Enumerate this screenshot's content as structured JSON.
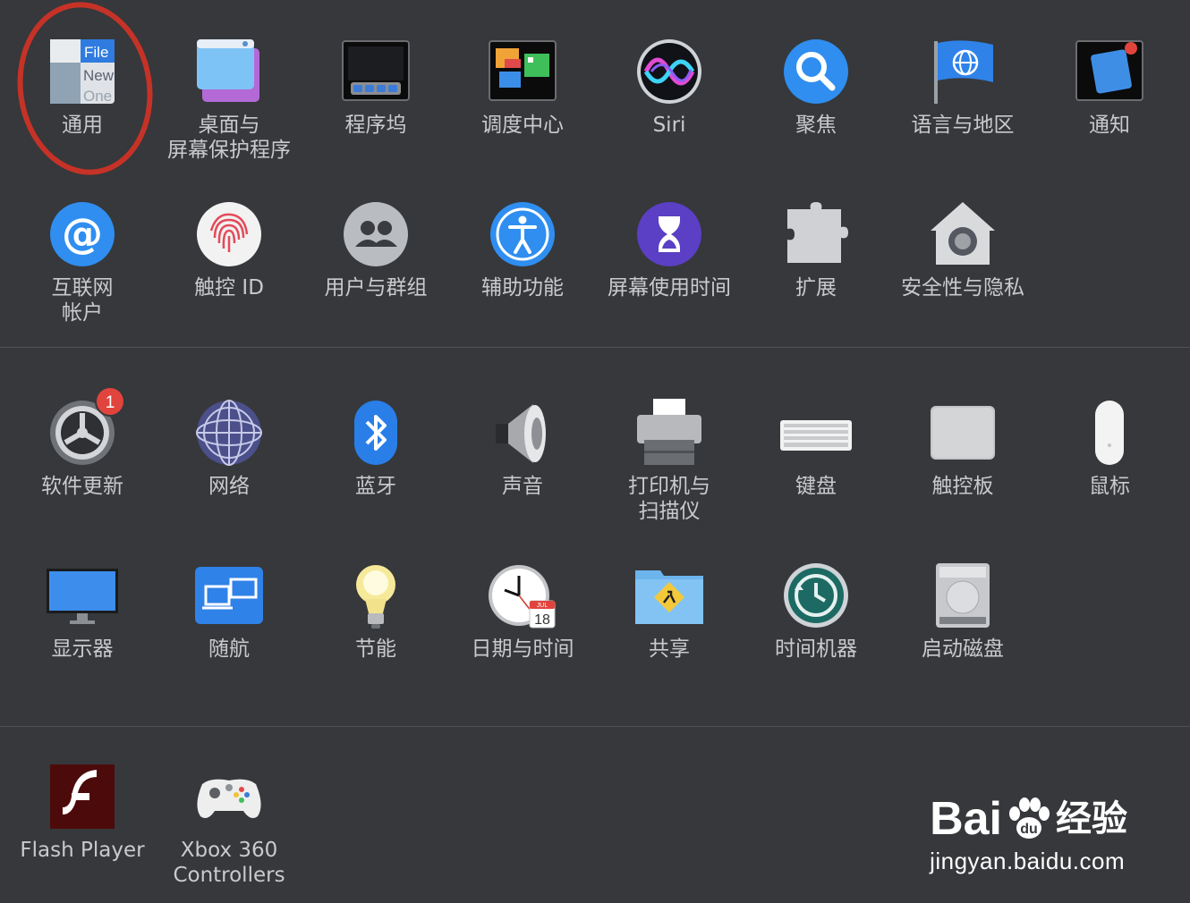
{
  "colors": {
    "background": "#36383b",
    "label": "#c9cacc",
    "annotation_red": "#c63227",
    "badge_red": "#e0443d"
  },
  "sections": [
    {
      "items": [
        {
          "label": "通用",
          "icon": "general-icon"
        },
        {
          "label": "桌面与\n屏幕保护程序",
          "icon": "desktop-screensaver-icon"
        },
        {
          "label": "程序坞",
          "icon": "dock-icon"
        },
        {
          "label": "调度中心",
          "icon": "mission-control-icon"
        },
        {
          "label": "Siri",
          "icon": "siri-icon"
        },
        {
          "label": "聚焦",
          "icon": "spotlight-icon"
        },
        {
          "label": "语言与地区",
          "icon": "language-region-icon"
        },
        {
          "label": "通知",
          "icon": "notifications-icon"
        },
        {
          "label": "互联网\n帐户",
          "icon": "internet-accounts-icon"
        },
        {
          "label": "触控 ID",
          "icon": "touch-id-icon"
        },
        {
          "label": "用户与群组",
          "icon": "users-groups-icon"
        },
        {
          "label": "辅助功能",
          "icon": "accessibility-icon"
        },
        {
          "label": "屏幕使用时间",
          "icon": "screen-time-icon"
        },
        {
          "label": "扩展",
          "icon": "extensions-icon"
        },
        {
          "label": "安全性与隐私",
          "icon": "security-privacy-icon"
        }
      ]
    },
    {
      "items": [
        {
          "label": "软件更新",
          "icon": "software-update-icon",
          "badge": "1"
        },
        {
          "label": "网络",
          "icon": "network-icon"
        },
        {
          "label": "蓝牙",
          "icon": "bluetooth-icon"
        },
        {
          "label": "声音",
          "icon": "sound-icon"
        },
        {
          "label": "打印机与\n扫描仪",
          "icon": "printers-scanners-icon"
        },
        {
          "label": "键盘",
          "icon": "keyboard-icon"
        },
        {
          "label": "触控板",
          "icon": "trackpad-icon"
        },
        {
          "label": "鼠标",
          "icon": "mouse-icon"
        },
        {
          "label": "显示器",
          "icon": "displays-icon"
        },
        {
          "label": "随航",
          "icon": "sidecar-icon"
        },
        {
          "label": "节能",
          "icon": "energy-saver-icon"
        },
        {
          "label": "日期与时间",
          "icon": "date-time-icon"
        },
        {
          "label": "共享",
          "icon": "sharing-icon"
        },
        {
          "label": "时间机器",
          "icon": "time-machine-icon"
        },
        {
          "label": "启动磁盘",
          "icon": "startup-disk-icon"
        }
      ]
    },
    {
      "items": [
        {
          "label": "Flash Player",
          "icon": "flash-player-icon"
        },
        {
          "label": "Xbox 360\nControllers",
          "icon": "xbox-controller-icon"
        }
      ]
    }
  ],
  "icon_text": {
    "general": [
      "File",
      "New",
      "One"
    ],
    "calendar_month": "JUL",
    "calendar_day": "18"
  },
  "watermark": {
    "logo_left": "Bai",
    "logo_du": "du",
    "logo_right": "经验",
    "url": "jingyan.baidu.com"
  }
}
